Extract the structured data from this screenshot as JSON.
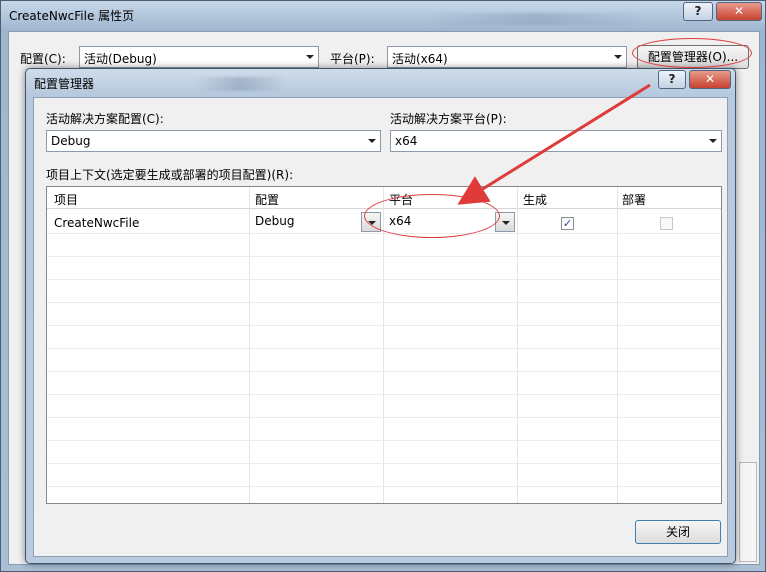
{
  "outer_window": {
    "title": "CreateNwcFile 属性页",
    "help_button": "?",
    "close_button": "✕",
    "config_label": "配置(C):",
    "config_value": "活动(Debug)",
    "platform_label": "平台(P):",
    "platform_value": "活动(x64)",
    "config_manager_button": "配置管理器(O)..."
  },
  "dialog": {
    "title": "配置管理器",
    "help_button": "?",
    "close_button": "✕",
    "active_config_label": "活动解决方案配置(C):",
    "active_config_value": "Debug",
    "active_platform_label": "活动解决方案平台(P):",
    "active_platform_value": "x64",
    "project_context_label": "项目上下文(选定要生成或部署的项目配置)(R):",
    "columns": [
      "项目",
      "配置",
      "平台",
      "生成",
      "部署"
    ],
    "rows": [
      {
        "project": "CreateNwcFile",
        "config": "Debug",
        "platform": "x64",
        "build": true,
        "deploy": false
      }
    ],
    "close_label": "关闭"
  },
  "annotation_color": "#e03b3b"
}
